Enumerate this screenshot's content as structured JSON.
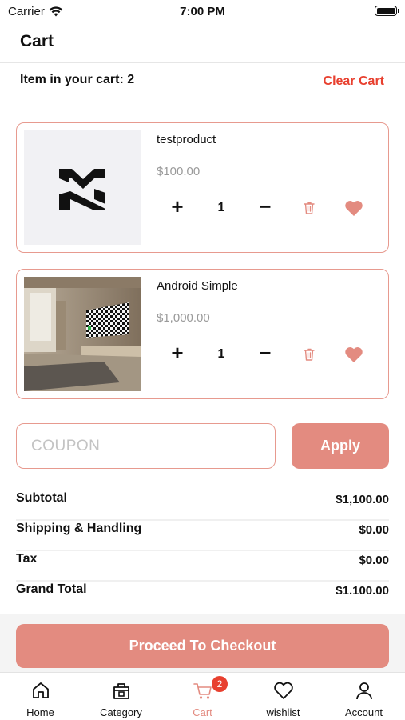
{
  "status_bar": {
    "carrier": "Carrier",
    "time": "7:00 PM"
  },
  "nav": {
    "title": "Cart"
  },
  "cart": {
    "count_label": "Item in your cart: 2",
    "clear_label": "Clear Cart"
  },
  "items": [
    {
      "name": "testproduct",
      "price": "$100.00",
      "quantity": "1",
      "plus": "+",
      "minus": "−",
      "image": "logo-image"
    },
    {
      "name": "Android Simple",
      "price": "$1,000.00",
      "quantity": "1",
      "plus": "+",
      "minus": "−",
      "image": "living-room-tv-photo"
    }
  ],
  "coupon": {
    "placeholder": "COUPON",
    "value": "",
    "apply_label": "Apply"
  },
  "summary": [
    {
      "label": "Subtotal",
      "value": "$1,100.00"
    },
    {
      "label": "Shipping & Handling",
      "value": "$0.00"
    },
    {
      "label": "Tax",
      "value": "$0.00"
    },
    {
      "label": "Grand Total",
      "value": "$1.100.00"
    }
  ],
  "checkout": {
    "label": "Proceed To Checkout"
  },
  "tabs": [
    {
      "label": "Home",
      "icon": "home-icon"
    },
    {
      "label": "Category",
      "icon": "category-icon"
    },
    {
      "label": "Cart",
      "icon": "cart-icon",
      "badge": "2",
      "active": true
    },
    {
      "label": "wishlist",
      "icon": "heart-icon"
    },
    {
      "label": "Account",
      "icon": "user-icon"
    }
  ],
  "colors": {
    "accent": "#e38b80",
    "danger": "#e8402f",
    "border": "#e79a8f",
    "muted": "#9a9a9a"
  }
}
